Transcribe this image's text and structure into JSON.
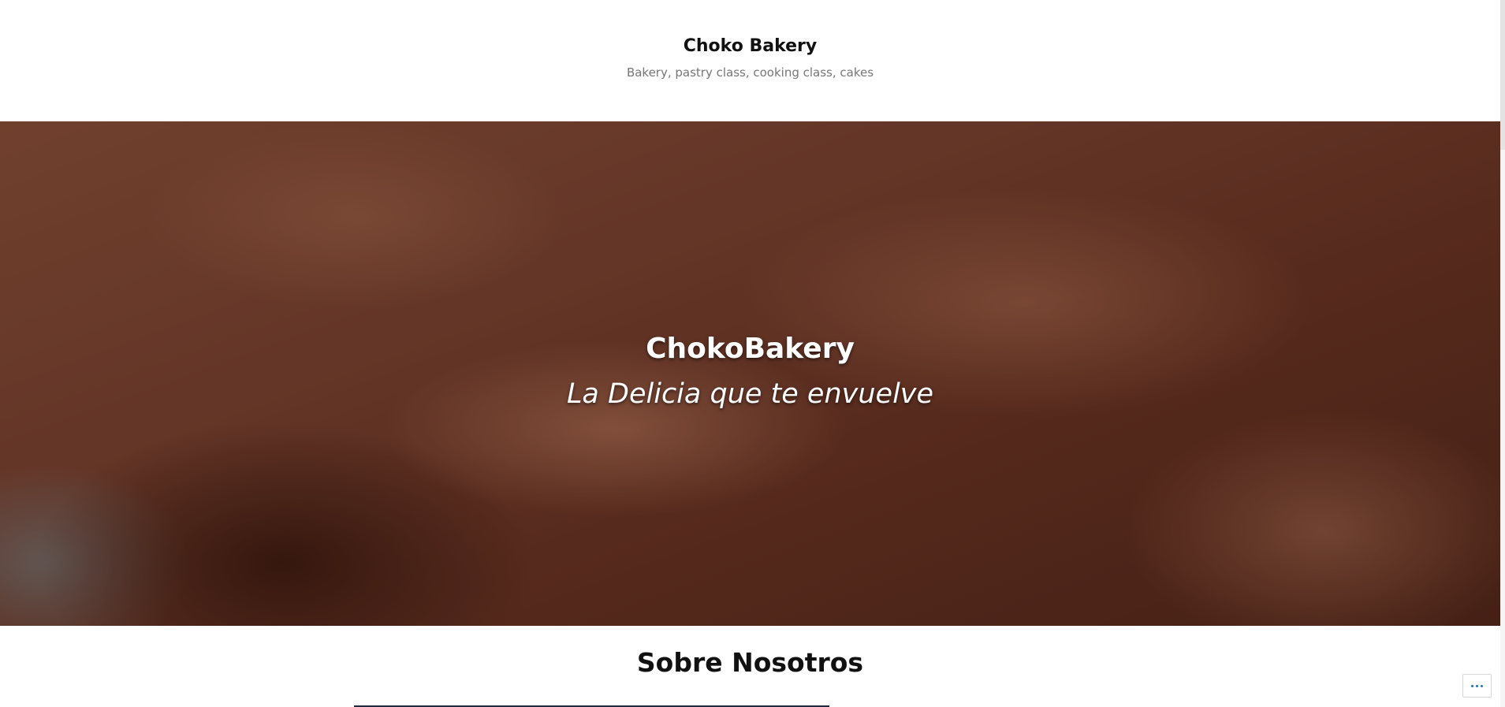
{
  "site": {
    "title": "Choko Bakery",
    "tagline": "Bakery, pastry class, cooking class, cakes"
  },
  "hero": {
    "title": "ChokoBakery",
    "subtitle": "La Delicia que te envuelve",
    "image_description_icon": "brownie-photo"
  },
  "section": {
    "heading": "Sobre Nosotros"
  },
  "actions": {
    "more_icon": "ellipsis-icon"
  },
  "colors": {
    "link_accent": "#2271b1",
    "title_text": "#111111",
    "tagline_text": "#767676"
  }
}
